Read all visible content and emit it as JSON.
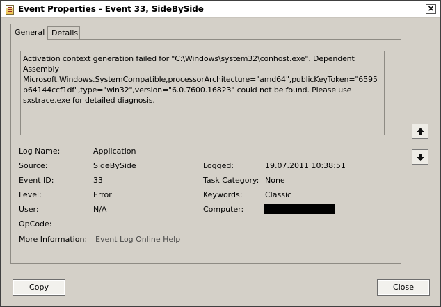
{
  "window": {
    "title": "Event Properties - Event 33, SideBySide",
    "close_glyph": "×"
  },
  "tabs": [
    {
      "label": "General",
      "active": true
    },
    {
      "label": "Details",
      "active": false
    }
  ],
  "description": "Activation context generation failed for \"C:\\Windows\\system32\\conhost.exe\". Dependent Assembly Microsoft.Windows.SystemCompatible,processorArchitecture=\"amd64\",publicKeyToken=\"6595b64144ccf1df\",type=\"win32\",version=\"6.0.7600.16823\" could not be found. Please use sxstrace.exe for detailed diagnosis.",
  "fields": {
    "log_name": {
      "label": "Log Name:",
      "value": "Application"
    },
    "source": {
      "label": "Source:",
      "value": "SideBySide"
    },
    "event_id": {
      "label": "Event ID:",
      "value": "33"
    },
    "level": {
      "label": "Level:",
      "value": "Error"
    },
    "user": {
      "label": "User:",
      "value": "N/A"
    },
    "opcode": {
      "label": "OpCode:",
      "value": ""
    },
    "more_info": {
      "label": "More Information:",
      "value": "Event Log Online Help"
    },
    "logged": {
      "label": "Logged:",
      "value": "19.07.2011 10:38:51"
    },
    "task_category": {
      "label": "Task Category:",
      "value": "None"
    },
    "keywords": {
      "label": "Keywords:",
      "value": "Classic"
    },
    "computer": {
      "label": "Computer:",
      "value": ""
    }
  },
  "buttons": {
    "copy": "Copy",
    "close": "Close"
  },
  "icons": {
    "up": "arrow-up-icon",
    "down": "arrow-down-icon"
  }
}
